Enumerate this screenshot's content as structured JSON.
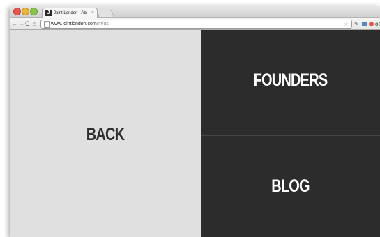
{
  "browser": {
    "tab_title": "Joint London - About Us",
    "tab_close": "×",
    "favicon_letter": "J",
    "url_host": "www.jointlondon.com",
    "url_path": "/#!/us",
    "nav": {
      "back": "←",
      "forward": "→",
      "reload": "C",
      "home": "⌂"
    },
    "star": "☆",
    "wrench": "✎",
    "glasses": "oo"
  },
  "page": {
    "back_label": "BACK",
    "founders_label": "FOUNDERS",
    "blog_label": "BLOG"
  },
  "colors": {
    "light_panel": "#e0e0e0",
    "dark_panel": "#2c2c2c",
    "dark_text": "#2f2f2f",
    "light_text": "#ffffff"
  }
}
